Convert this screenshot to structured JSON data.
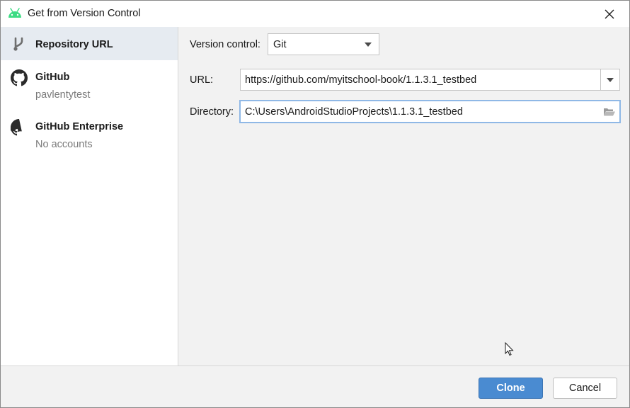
{
  "window": {
    "title": "Get from Version Control"
  },
  "sidebar": {
    "items": [
      {
        "label": "Repository URL",
        "sub": "",
        "icon": "vcs-branch-icon",
        "selected": true
      },
      {
        "label": "GitHub",
        "sub": "pavlentytest",
        "icon": "github-icon",
        "selected": false
      },
      {
        "label": "GitHub Enterprise",
        "sub": "No accounts",
        "icon": "github-icon",
        "selected": false
      }
    ]
  },
  "form": {
    "version_control_label": "Version control:",
    "version_control_value": "Git",
    "url_label": "URL:",
    "url_value": "https://github.com/myitschool-book/1.1.3.1_testbed",
    "directory_label": "Directory:",
    "directory_value": "C:\\Users\\AndroidStudioProjects\\1.1.3.1_testbed"
  },
  "footer": {
    "clone_label": "Clone",
    "cancel_label": "Cancel"
  },
  "colors": {
    "accent": "#4a8bd1",
    "selection": "#e6ebf1",
    "android_green": "#3ddc84",
    "focus_ring": "#8fb8e6"
  }
}
